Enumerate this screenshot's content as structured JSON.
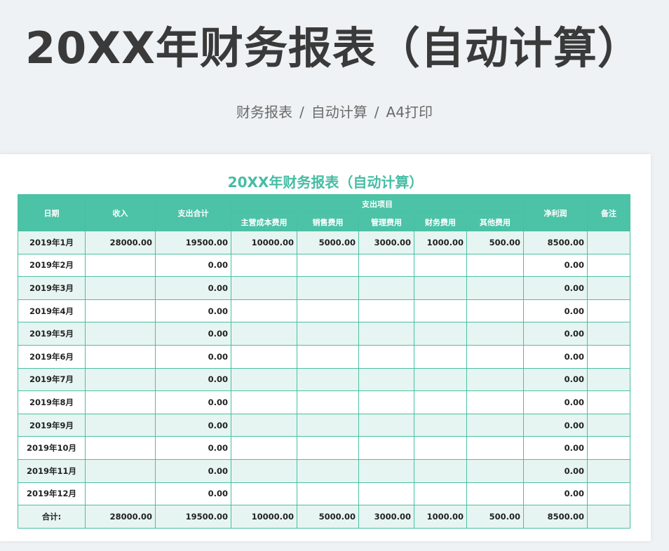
{
  "hero": {
    "title": "20XX年财务报表（自动计算）",
    "breadcrumb": [
      "财务报表",
      "自动计算",
      "A4打印"
    ],
    "separator": "/"
  },
  "sheet": {
    "title": "20XX年财务报表（自动计算）",
    "headers": {
      "date": "日期",
      "income": "收入",
      "expense_total": "支出合计",
      "expense_items": "支出项目",
      "net_profit": "净利润",
      "remarks": "备注",
      "sub": [
        "主营成本费用",
        "销售费用",
        "管理费用",
        "财务费用",
        "其他费用"
      ]
    },
    "rows": [
      {
        "date": "2019年1月",
        "income": "28000.00",
        "expense_total": "19500.00",
        "main_cost": "10000.00",
        "sales": "5000.00",
        "admin": "3000.00",
        "finance": "1000.00",
        "other": "500.00",
        "net": "8500.00",
        "remark": ""
      },
      {
        "date": "2019年2月",
        "income": "",
        "expense_total": "0.00",
        "main_cost": "",
        "sales": "",
        "admin": "",
        "finance": "",
        "other": "",
        "net": "0.00",
        "remark": ""
      },
      {
        "date": "2019年3月",
        "income": "",
        "expense_total": "0.00",
        "main_cost": "",
        "sales": "",
        "admin": "",
        "finance": "",
        "other": "",
        "net": "0.00",
        "remark": ""
      },
      {
        "date": "2019年4月",
        "income": "",
        "expense_total": "0.00",
        "main_cost": "",
        "sales": "",
        "admin": "",
        "finance": "",
        "other": "",
        "net": "0.00",
        "remark": ""
      },
      {
        "date": "2019年5月",
        "income": "",
        "expense_total": "0.00",
        "main_cost": "",
        "sales": "",
        "admin": "",
        "finance": "",
        "other": "",
        "net": "0.00",
        "remark": ""
      },
      {
        "date": "2019年6月",
        "income": "",
        "expense_total": "0.00",
        "main_cost": "",
        "sales": "",
        "admin": "",
        "finance": "",
        "other": "",
        "net": "0.00",
        "remark": ""
      },
      {
        "date": "2019年7月",
        "income": "",
        "expense_total": "0.00",
        "main_cost": "",
        "sales": "",
        "admin": "",
        "finance": "",
        "other": "",
        "net": "0.00",
        "remark": ""
      },
      {
        "date": "2019年8月",
        "income": "",
        "expense_total": "0.00",
        "main_cost": "",
        "sales": "",
        "admin": "",
        "finance": "",
        "other": "",
        "net": "0.00",
        "remark": ""
      },
      {
        "date": "2019年9月",
        "income": "",
        "expense_total": "0.00",
        "main_cost": "",
        "sales": "",
        "admin": "",
        "finance": "",
        "other": "",
        "net": "0.00",
        "remark": ""
      },
      {
        "date": "2019年10月",
        "income": "",
        "expense_total": "0.00",
        "main_cost": "",
        "sales": "",
        "admin": "",
        "finance": "",
        "other": "",
        "net": "0.00",
        "remark": ""
      },
      {
        "date": "2019年11月",
        "income": "",
        "expense_total": "0.00",
        "main_cost": "",
        "sales": "",
        "admin": "",
        "finance": "",
        "other": "",
        "net": "0.00",
        "remark": ""
      },
      {
        "date": "2019年12月",
        "income": "",
        "expense_total": "0.00",
        "main_cost": "",
        "sales": "",
        "admin": "",
        "finance": "",
        "other": "",
        "net": "0.00",
        "remark": ""
      }
    ],
    "total": {
      "label": "合计:",
      "income": "28000.00",
      "expense_total": "19500.00",
      "main_cost": "10000.00",
      "sales": "5000.00",
      "admin": "3000.00",
      "finance": "1000.00",
      "other": "500.00",
      "net": "8500.00",
      "remark": ""
    }
  },
  "colors": {
    "accent": "#4cc2a7",
    "title_accent": "#46bda4",
    "band": "#e6f5f1",
    "hero_text": "#3a3a3a"
  }
}
